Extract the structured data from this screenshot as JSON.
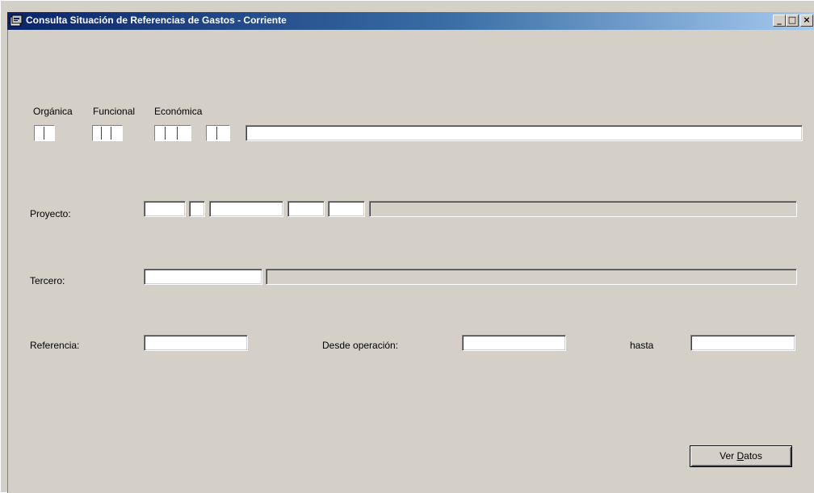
{
  "window": {
    "title": "Consulta Situación de Referencias de Gastos - Corriente",
    "controls": {
      "minimize": "_",
      "maximize": "□",
      "close": "×"
    }
  },
  "labels": {
    "organica": "Orgánica",
    "funcional": "Funcional",
    "economica": "Económica",
    "proyecto": "Proyecto:",
    "tercero": "Tercero:",
    "referencia": "Referencia:",
    "desde_operacion": "Desde operación:",
    "hasta": "hasta"
  },
  "fields": {
    "organica": "",
    "funcional": "",
    "economica_1": "",
    "economica_2": "",
    "aplicacion_descripcion": "",
    "proyecto_1": "",
    "proyecto_2": "",
    "proyecto_3": "",
    "proyecto_4": "",
    "proyecto_5": "",
    "proyecto_descripcion": "",
    "tercero_codigo": "",
    "tercero_nombre": "",
    "referencia": "",
    "desde_operacion": "",
    "hasta": ""
  },
  "buttons": {
    "ver_datos_prefix": "Ver ",
    "ver_datos_mnemonic": "D",
    "ver_datos_suffix": "atos"
  }
}
